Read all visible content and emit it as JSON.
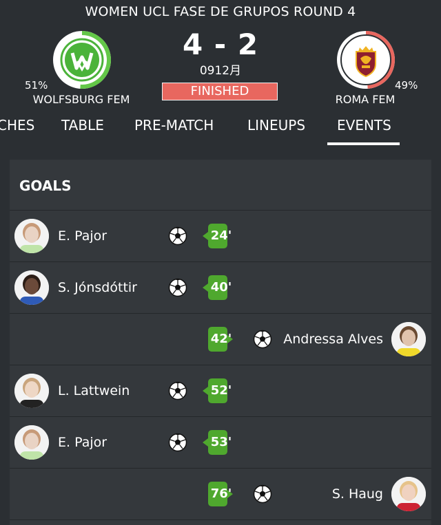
{
  "match": {
    "competition": "WOMEN UCL  FASE DE GRUPOS ROUND 4",
    "score": "4 - 2",
    "date": "0912月",
    "status": "FINISHED",
    "status_color": "#e8675f"
  },
  "home": {
    "name": "WOLFSBURG FEM",
    "pct": "51%",
    "possession": 0.51,
    "ring_color": "#63c748",
    "logo_icon": "wolfsburg-crest-icon"
  },
  "away": {
    "name": "ROMA FEM",
    "pct": "49%",
    "possession": 0.49,
    "ring_color": "#e8675f",
    "logo_icon": "roma-crest-icon"
  },
  "tabs": [
    {
      "label": "CHES"
    },
    {
      "label": "TABLE"
    },
    {
      "label": "PRE-MATCH"
    },
    {
      "label": "LINEUPS"
    },
    {
      "label": "EVENTS",
      "active": true
    }
  ],
  "events": {
    "section_title": "GOALS",
    "goals": [
      {
        "side": "home",
        "player": "E. Pajor",
        "minute": "24'"
      },
      {
        "side": "home",
        "player": "S. Jónsdóttir",
        "minute": "40'"
      },
      {
        "side": "away",
        "player": "Andressa Alves",
        "minute": "42'"
      },
      {
        "side": "home",
        "player": "L. Lattwein",
        "minute": "52'"
      },
      {
        "side": "home",
        "player": "E. Pajor",
        "minute": "53'"
      },
      {
        "side": "away",
        "player": "S. Haug",
        "minute": "76'"
      }
    ]
  },
  "colors": {
    "minute_pill": "#4fa82e",
    "bg": "#2b2f33",
    "panel": "#34383c"
  }
}
